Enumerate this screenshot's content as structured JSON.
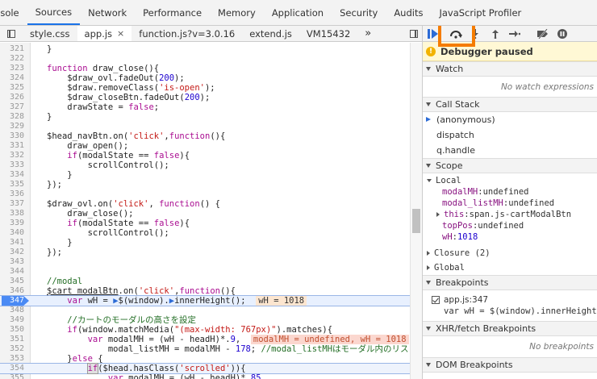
{
  "top_tabs": [
    {
      "label": "onsole",
      "active": false
    },
    {
      "label": "Sources",
      "active": true
    },
    {
      "label": "Network",
      "active": false
    },
    {
      "label": "Performance",
      "active": false
    },
    {
      "label": "Memory",
      "active": false
    },
    {
      "label": "Application",
      "active": false
    },
    {
      "label": "Security",
      "active": false
    },
    {
      "label": "Audits",
      "active": false
    },
    {
      "label": "JavaScript Profiler",
      "active": false
    }
  ],
  "file_tabs": [
    {
      "label": "style.css",
      "active": false,
      "closable": false
    },
    {
      "label": "app.js",
      "active": true,
      "closable": true
    },
    {
      "label": "function.js?v=3.0.16",
      "active": false,
      "closable": false
    },
    {
      "label": "extend.js",
      "active": false,
      "closable": false
    },
    {
      "label": "VM15432",
      "active": false,
      "closable": false
    }
  ],
  "file_tabs_overflow": "»",
  "close_glyph": "×",
  "code": {
    "paused_line": "347",
    "lines": [
      {
        "n": "321",
        "html": "        }"
      },
      {
        "n": "322",
        "html": ""
      },
      {
        "n": "323",
        "html": "        <span class='kw'>function</span> draw_close(){"
      },
      {
        "n": "324",
        "html": "            $draw_ovl.fadeOut(<span class='num'>200</span>);"
      },
      {
        "n": "325",
        "html": "            $draw.removeClass(<span class='str'>'is-open'</span>);"
      },
      {
        "n": "326",
        "html": "            $draw_closeBtn.fadeOut(<span class='num'>200</span>);"
      },
      {
        "n": "327",
        "html": "            drawState = <span class='kw'>false</span>;"
      },
      {
        "n": "328",
        "html": "        }"
      },
      {
        "n": "329",
        "html": ""
      },
      {
        "n": "330",
        "html": "        $head_navBtn.on(<span class='str'>'click'</span>,<span class='kw'>function</span>(){"
      },
      {
        "n": "331",
        "html": "            draw_open();"
      },
      {
        "n": "332",
        "html": "            <span class='kw'>if</span>(modalState == <span class='kw'>false</span>){"
      },
      {
        "n": "333",
        "html": "                scrollControl();"
      },
      {
        "n": "334",
        "html": "            }"
      },
      {
        "n": "335",
        "html": "        });"
      },
      {
        "n": "336",
        "html": ""
      },
      {
        "n": "337",
        "html": "        $draw_ovl.on(<span class='str'>'click'</span>, <span class='kw'>function</span>() {"
      },
      {
        "n": "338",
        "html": "            draw_close();"
      },
      {
        "n": "339",
        "html": "            <span class='kw'>if</span>(modalState == <span class='kw'>false</span>){"
      },
      {
        "n": "340",
        "html": "                scrollControl();"
      },
      {
        "n": "341",
        "html": "            }"
      },
      {
        "n": "342",
        "html": "        });"
      },
      {
        "n": "343",
        "html": ""
      },
      {
        "n": "344",
        "html": ""
      },
      {
        "n": "345",
        "html": "        <span class='cmt'>//modal</span>"
      },
      {
        "n": "346",
        "html": "        <span style='text-decoration:underline'>$cart_modalBtn</span>.on(<span class='str'>'click'</span>,<span class='kw'>function</span>(){"
      },
      {
        "n": "347",
        "html": "            <span class='kw'>var</span> wH = <span style='color:#2c6bd6'>▶</span>$(window).<span style='color:#2c6bd6'>▶</span>innerHeight();  <span class='ev-inline'>wH = 1018</span>"
      },
      {
        "n": "348",
        "html": ""
      },
      {
        "n": "349",
        "html": "            <span class='cmt'>//カートのモーダルの高さを設定</span>"
      },
      {
        "n": "350",
        "html": "            <span class='kw'>if</span>(window.matchMedia(<span class='str'>\"(max-width: 767px)\"</span>).matches){"
      },
      {
        "n": "351",
        "html": "                <span class='kw'>var</span> modalMH = (wH - headH)*.<span class='num'>9</span>,  <span class='ev-inline pink'>modalMH = undefined, wH = 1018</span>"
      },
      {
        "n": "352",
        "html": "                    modal_listMH = modalMH - <span class='num'>178</span>; <span class='cmt'>//modal_listMHはモーダル内のリス</span>"
      },
      {
        "n": "353",
        "html": "            }<span class='kw'>else</span> {"
      },
      {
        "n": "354",
        "html": "                <span class='hl-sel'><span class='kw'>if</span></span>($head.hasClass(<span class='str'>'scrolled'</span>)){"
      },
      {
        "n": "355",
        "html": "                    <span class='kw'>var</span> modalMH = (wH - headH)*.<span class='num'>85</span>"
      }
    ]
  },
  "debugger": {
    "paused_label": "Debugger paused",
    "watch": {
      "title": "Watch",
      "empty": "No watch expressions"
    },
    "call_stack": {
      "title": "Call Stack",
      "frames": [
        "(anonymous)",
        "dispatch",
        "q.handle"
      ]
    },
    "scope": {
      "title": "Scope",
      "local_label": "Local",
      "vars": [
        {
          "name": "modalMH",
          "sep": ": ",
          "value": "undefined",
          "expand": false
        },
        {
          "name": "modal_listMH",
          "sep": ": ",
          "value": "undefined",
          "expand": false
        },
        {
          "name": "this",
          "sep": ": ",
          "value": "span.js-cartModalBtn",
          "expand": true
        },
        {
          "name": "topPos",
          "sep": ": ",
          "value": "undefined",
          "expand": false
        },
        {
          "name": "wH",
          "sep": ": ",
          "value": "1018",
          "expand": false
        }
      ],
      "closure_label": "Closure (2)",
      "global_label": "Global"
    },
    "breakpoints": {
      "title": "Breakpoints",
      "file": "app.js:347",
      "code": "var wH = $(window).innerHeight();"
    },
    "xhr": {
      "title": "XHR/fetch Breakpoints",
      "empty": "No breakpoints"
    },
    "dom": {
      "title": "DOM Breakpoints"
    }
  },
  "colors": {
    "highlight_box": "#f57c00",
    "active_tab_underline": "#1a73e8",
    "paused_bg": "#fff8d5"
  }
}
